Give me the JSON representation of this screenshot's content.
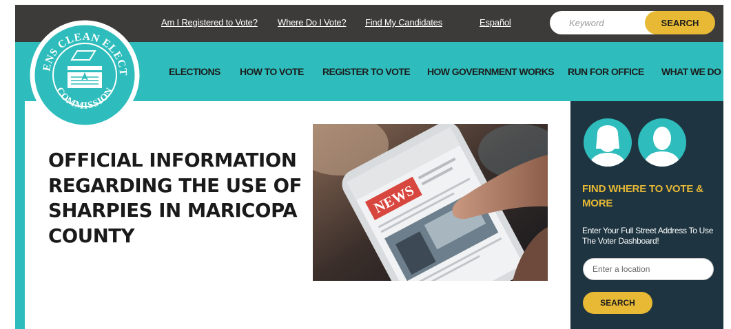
{
  "top_links": {
    "registered": "Am I Registered to Vote?",
    "where_vote": "Where Do I Vote?",
    "candidates": "Find My Candidates",
    "espanol": "Español"
  },
  "search": {
    "placeholder": "Keyword",
    "button_label": "SEARCH"
  },
  "nav": {
    "elections": "ELECTIONS",
    "how_to_vote": "HOW TO VOTE",
    "register": "REGISTER TO VOTE",
    "government": "HOW GOVERNMENT WORKS",
    "run": "RUN FOR OFFICE",
    "what_we_do": "WHAT WE DO"
  },
  "logo": {
    "top_text": "CITIZENS CLEAN ELECTIONS",
    "bottom_text": "COMMISSION"
  },
  "headline": "OFFICIAL INFORMATION REGARDING THE USE OF SHARPIES IN MARICOPA COUNTY",
  "photo": {
    "news_label": "NEWS"
  },
  "sidebar": {
    "title": "FIND WHERE TO VOTE & MORE",
    "description": "Enter Your Full Street Address To Use The Voter Dashboard!",
    "location_placeholder": "Enter a location",
    "button_label": "SEARCH"
  },
  "colors": {
    "teal": "#2ebdbc",
    "dark_bar": "#3c3b3a",
    "sidebar_navy": "#1e3541",
    "accent_gold": "#e8b935"
  }
}
